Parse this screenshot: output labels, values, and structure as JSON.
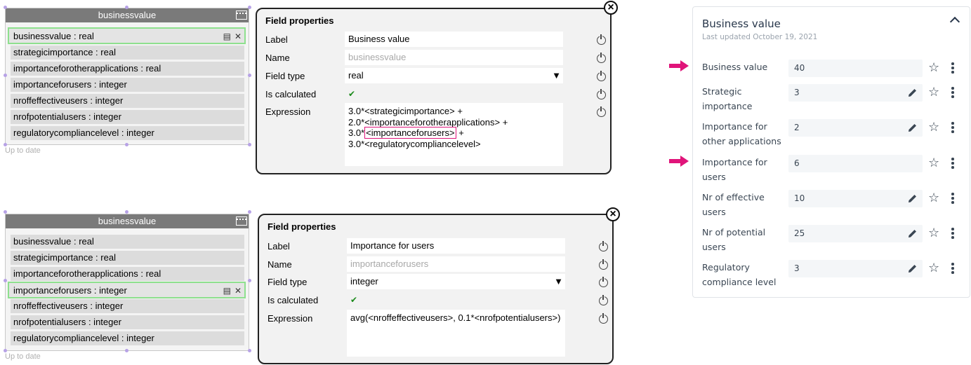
{
  "class_boxes": [
    {
      "title": "businessvalue",
      "status": "Up to date",
      "attributes": [
        "businessvalue : real",
        "strategicimportance : real",
        "importanceforotherapplications : real",
        "importanceforusers : integer",
        "nroffeffectiveusers : integer",
        "nrofpotentialusers : integer",
        "regulatorycompliancelevel : integer"
      ]
    },
    {
      "title": "businessvalue",
      "status": "Up to date",
      "attributes": [
        "businessvalue : real",
        "strategicimportance : real",
        "importanceforotherapplications : real",
        "importanceforusers : integer",
        "nroffeffectiveusers : integer",
        "nrofpotentialusers : integer",
        "regulatorycompliancelevel : integer"
      ]
    }
  ],
  "field_panels": [
    {
      "title": "Field properties",
      "labels": {
        "label": "Label",
        "name": "Name",
        "type": "Field type",
        "calc": "Is calculated",
        "expr": "Expression"
      },
      "label_value": "Business value",
      "name_value": "businessvalue",
      "type_value": "real",
      "is_calculated": "✔",
      "expression": {
        "line1": "3.0*<strategicimportance> +",
        "line2": "2.0*<importanceforotherapplications> +",
        "line3_pre": "3.0*",
        "line3_hl": "<importanceforusers>",
        "line3_post": " +",
        "line4": "3.0*<regulatorycompliancelevel>"
      }
    },
    {
      "title": "Field properties",
      "labels": {
        "label": "Label",
        "name": "Name",
        "type": "Field type",
        "calc": "Is calculated",
        "expr": "Expression"
      },
      "label_value": "Importance for users",
      "name_value": "importanceforusers",
      "type_value": "integer",
      "is_calculated": "✔",
      "expression": {
        "line1": "avg(<nroffeffectiveusers>, 0.1*<nrofpotentialusers>)"
      }
    }
  ],
  "card": {
    "title": "Business value",
    "subtitle": "Last updated October 19, 2021",
    "rows": [
      {
        "label": "Business value",
        "value": "40",
        "editable": false,
        "highlighted": true
      },
      {
        "label": "Strategic importance",
        "value": "3",
        "editable": true,
        "highlighted": false
      },
      {
        "label": "Importance for other applications",
        "value": "2",
        "editable": true,
        "highlighted": false
      },
      {
        "label": "Importance for users",
        "value": "6",
        "editable": false,
        "highlighted": true
      },
      {
        "label": "Nr of effective users",
        "value": "10",
        "editable": true,
        "highlighted": false
      },
      {
        "label": "Nr of potential users",
        "value": "25",
        "editable": true,
        "highlighted": false
      },
      {
        "label": "Regulatory compliance level",
        "value": "3",
        "editable": true,
        "highlighted": false
      }
    ]
  },
  "colors": {
    "accent_arrow": "#e0147a",
    "selection_border": "#8ee08e",
    "highlight_border": "#e0147a",
    "check_green": "#1a8a1a"
  },
  "icons": [
    "window-icon",
    "document-icon",
    "close-x-icon",
    "power-icon",
    "dropdown-arrow-icon",
    "check-icon",
    "close-circle-icon",
    "chevron-up-icon",
    "pencil-icon",
    "star-icon",
    "kebab-menu-icon",
    "arrow-right-icon"
  ]
}
